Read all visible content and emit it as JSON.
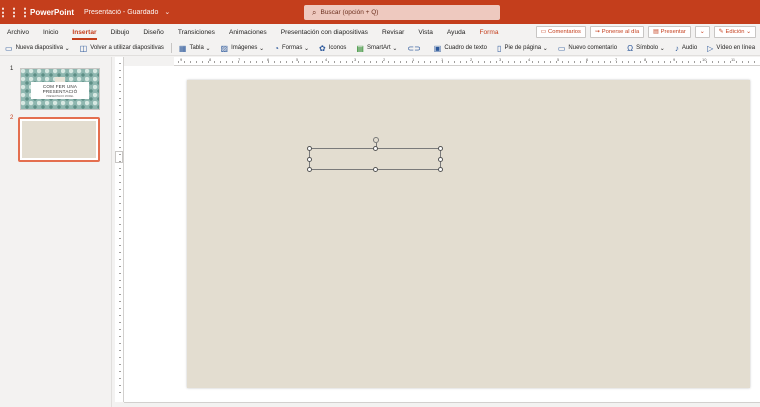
{
  "titlebar": {
    "app_name": "PowerPoint",
    "document_name": "Presentació - Guardado",
    "chevron": "⌄",
    "search_placeholder": "Buscar (opción + Q)"
  },
  "tabs": [
    "Archivo",
    "Inicio",
    "Insertar",
    "Dibujo",
    "Diseño",
    "Transiciones",
    "Animaciones",
    "Presentación con diapositivas",
    "Revisar",
    "Vista",
    "Ayuda",
    "Forma"
  ],
  "active_tab": "Insertar",
  "right_buttons": {
    "comments": "Comentarios",
    "catch_up": "Ponerse al día",
    "present": "Presentar",
    "editing": "Edición"
  },
  "ribbon": {
    "new_slide": "Nueva diapositiva",
    "reuse": "Volver a utilizar diapositivas",
    "table": "Tabla",
    "images": "Imágenes",
    "shapes": "Formas",
    "icons": "Iconos",
    "smartart": "SmartArt",
    "textbox": "Cuadro de texto",
    "footer": "Pie de página",
    "new_comment": "Nuevo comentario",
    "symbol": "Símbolo",
    "audio": "Audio",
    "video": "Vídeo en línea"
  },
  "slides": {
    "slide1_number": "1",
    "slide1_title_line1": "COM FER UNA",
    "slide1_title_line2": "PRESENTACIÓ",
    "slide1_subtitle": "PRESENTACIO MODEL",
    "slide2_number": "2"
  },
  "ruler_numbers": [
    "9",
    "8",
    "7",
    "6",
    "5",
    "4",
    "3",
    "2",
    "1",
    "1",
    "2",
    "3",
    "4",
    "5",
    "6",
    "7",
    "8",
    "9",
    "10",
    "11"
  ],
  "colors": {
    "brand": "#c43e1c",
    "slide_background": "#e3ddd0",
    "selection_border": "#e46f4f"
  }
}
